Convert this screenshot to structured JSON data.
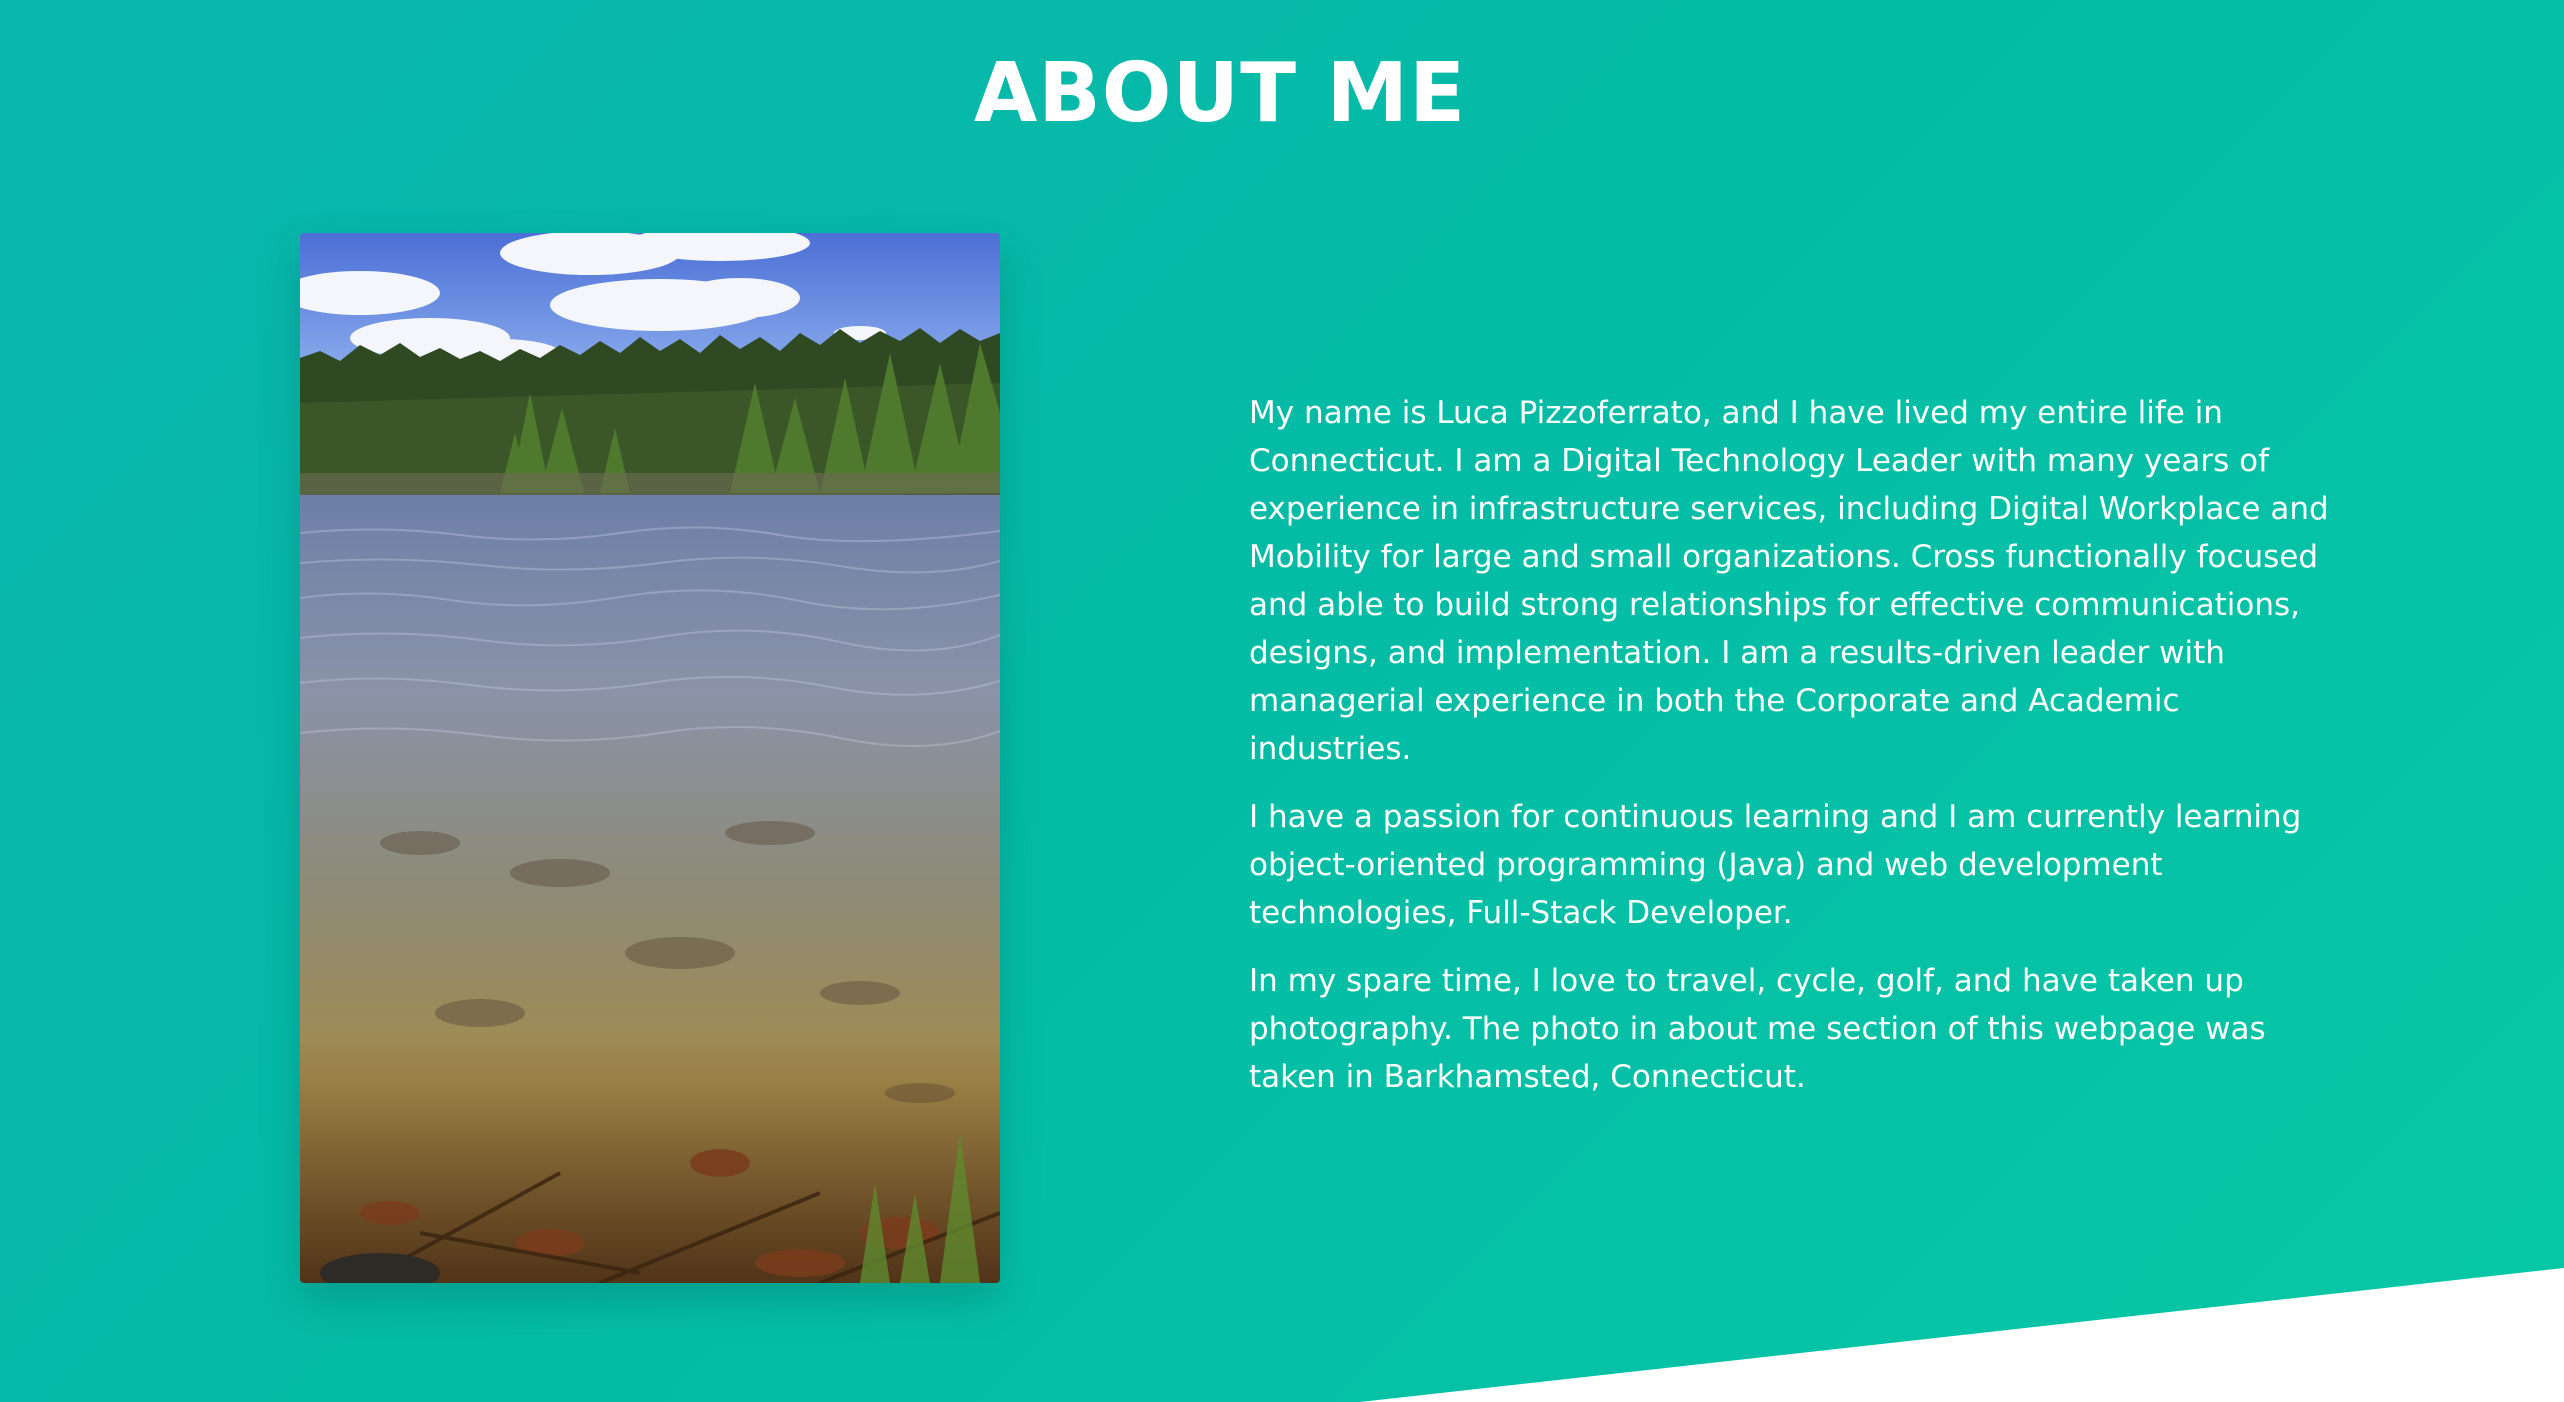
{
  "about": {
    "title": "ABOUT ME",
    "paragraphs": [
      "My name is Luca Pizzoferrato, and I have lived my entire life in Connecticut. I am a Digital Technology Leader with many years of experience in infrastructure services, including Digital Workplace and Mobility for large and small organizations. Cross functionally focused and able to build strong relationships for effective communications, designs, and implementation. I am a results-driven leader with managerial experience in both the Corporate and Academic industries.",
      "I have a passion for continuous learning and I am currently learning object-oriented programming (Java) and web development technologies, Full-Stack Developer.",
      "In my spare time, I love to travel, cycle, golf, and have taken up photography. The photo in about me section of this webpage was taken in Barkhamsted, Connecticut."
    ]
  },
  "colors": {
    "background": "#04bba6",
    "text": "#ffffff",
    "wedge": "#ffffff"
  }
}
